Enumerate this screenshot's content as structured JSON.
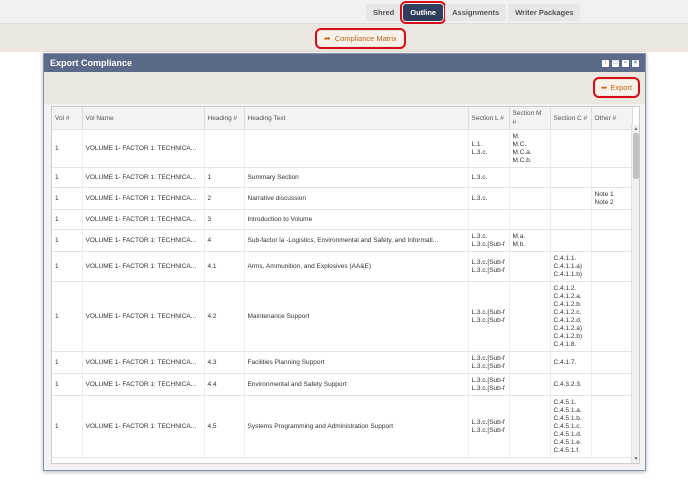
{
  "nav": {
    "tabs": [
      "Shred",
      "Outline",
      "Assignments",
      "Writer Packages"
    ],
    "active": "Outline"
  },
  "toolbar": {
    "compliance_matrix_label": "Compliance Matrix"
  },
  "modal": {
    "title": "Export Compliance",
    "export_label": "Export"
  },
  "table": {
    "columns": [
      "Vol #",
      "Vol Name",
      "Heading #",
      "Heading Text",
      "Section L #",
      "Section M #",
      "Section C #",
      "Other #"
    ],
    "rows": [
      {
        "vol": "1",
        "vol_name": "VOLUME 1- FACTOR 1: TECHNICA...",
        "heading_num": "",
        "heading_text": "",
        "sec_l": [
          "L.1.",
          "L.3.c."
        ],
        "sec_m": [
          "M.",
          "M.C.",
          "M.C.a.",
          "M.C.b."
        ],
        "sec_c": [],
        "other": []
      },
      {
        "vol": "1",
        "vol_name": "VOLUME 1- FACTOR 1: TECHNICA...",
        "heading_num": "1",
        "heading_text": "Summary Section",
        "sec_l": [
          "L.3.c."
        ],
        "sec_m": [],
        "sec_c": [],
        "other": []
      },
      {
        "vol": "1",
        "vol_name": "VOLUME 1- FACTOR 1: TECHNICA...",
        "heading_num": "2",
        "heading_text": "Narrative discussion",
        "sec_l": [
          "L.3.c."
        ],
        "sec_m": [],
        "sec_c": [],
        "other": [
          "Note 1",
          "Note 2"
        ]
      },
      {
        "vol": "1",
        "vol_name": "VOLUME 1- FACTOR 1: TECHNICA...",
        "heading_num": "3",
        "heading_text": "Introduction to Volume",
        "sec_l": [],
        "sec_m": [],
        "sec_c": [],
        "other": []
      },
      {
        "vol": "1",
        "vol_name": "VOLUME 1- FACTOR 1: TECHNICA...",
        "heading_num": "4",
        "heading_text": "Sub-factor la -Logistics, Environmental and Safety, and Informati...",
        "sec_l": [
          "L.3.c.",
          "L.3.c.[Sub-f"
        ],
        "sec_m": [
          "M.a.",
          "M.b."
        ],
        "sec_c": [],
        "other": []
      },
      {
        "vol": "1",
        "vol_name": "VOLUME 1- FACTOR 1: TECHNICA...",
        "heading_num": "4.1",
        "heading_text": "Arms, Ammunition, and Explosives (AA&E)",
        "sec_l": [
          "L.3.c.[Sub-f",
          "L.3.c.[Sub-f"
        ],
        "sec_m": [],
        "sec_c": [
          "C.4.1.1.",
          "C.4.1.1.a)",
          "C.4.1.1.b)"
        ],
        "other": []
      },
      {
        "vol": "1",
        "vol_name": "VOLUME 1- FACTOR 1: TECHNICA...",
        "heading_num": "4.2",
        "heading_text": "Maintenance Support",
        "sec_l": [
          "L.3.c.[Sub-f",
          "L.3.c.[Sub-f"
        ],
        "sec_m": [],
        "sec_c": [
          "C.4.1.2.",
          "C.4.1.2.a.",
          "C.4.1.2.b.",
          "C.4.1.2.c.",
          "C.4.1.2.d.",
          "C.4.1.2.a)",
          "C.4.1.2.b)",
          "C.4.1.8."
        ],
        "other": []
      },
      {
        "vol": "1",
        "vol_name": "VOLUME 1- FACTOR 1: TECHNICA...",
        "heading_num": "4.3",
        "heading_text": "Facilities Planning Support",
        "sec_l": [
          "L.3.c.[Sub-f",
          "L.3.c.[Sub-f"
        ],
        "sec_m": [],
        "sec_c": [
          "C.4.1.7."
        ],
        "other": []
      },
      {
        "vol": "1",
        "vol_name": "VOLUME 1- FACTOR 1: TECHNICA...",
        "heading_num": "4.4",
        "heading_text": "Environmental and Safety Support",
        "sec_l": [
          "L.3.c.[Sub-f",
          "L.3.c.[Sub-f"
        ],
        "sec_m": [],
        "sec_c": [
          "C.4.3.2.3."
        ],
        "other": []
      },
      {
        "vol": "1",
        "vol_name": "VOLUME 1- FACTOR 1: TECHNICA...",
        "heading_num": "4.5",
        "heading_text": "Systems Programming and Administration Support",
        "sec_l": [
          "L.3.c.[Sub-f",
          "L.3.c.[Sub-f"
        ],
        "sec_m": [],
        "sec_c": [
          "C.4.5.1.",
          "C.4.5.1.a.",
          "C.4.5.1.b.",
          "C.4.5.1.c.",
          "C.4.5.1.d.",
          "C.4.5.1.e.",
          "C.4.5.1.f."
        ],
        "other": []
      }
    ]
  },
  "colors": {
    "accent": "#c0641a",
    "highlight": "#d50f1a",
    "header": "#5a6a88",
    "nav_active": "#2f3e5c"
  },
  "icons": {
    "compliance_matrix": "share-icon",
    "export": "share-icon",
    "scroll_up": "chevron-up-icon",
    "scroll_down": "chevron-down-icon"
  }
}
